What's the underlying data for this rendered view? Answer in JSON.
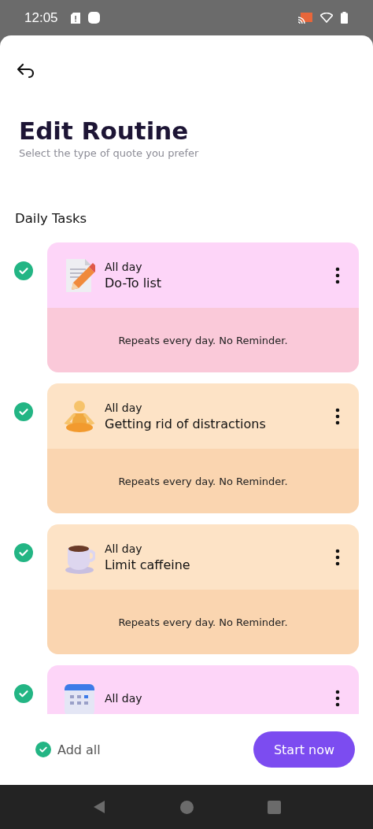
{
  "status_bar": {
    "time": "12:05"
  },
  "header": {
    "title": "Edit Routine",
    "subtitle": "Select the type of quote you prefer"
  },
  "section": {
    "title": "Daily Tasks"
  },
  "tasks": [
    {
      "kind": "notepad",
      "when": "All day",
      "title": "Do-To list",
      "repeat": "Repeats every day. No Reminder.",
      "checked": true,
      "color": "#fdd5f8"
    },
    {
      "kind": "meditation",
      "when": "All day",
      "title": "Getting rid of distractions",
      "repeat": "Repeats every day. No Reminder.",
      "checked": true,
      "color": "#fde3c6"
    },
    {
      "kind": "coffee",
      "when": "All day",
      "title": "Limit caffeine",
      "repeat": "Repeats every day. No Reminder.",
      "checked": true,
      "color": "#fde3c6"
    },
    {
      "kind": "calendar",
      "when": "All day",
      "checked": true,
      "color": "#fdd5f8"
    }
  ],
  "footer": {
    "add_all": {
      "label": "Add all",
      "checked": true
    },
    "start_button": "Start now"
  }
}
